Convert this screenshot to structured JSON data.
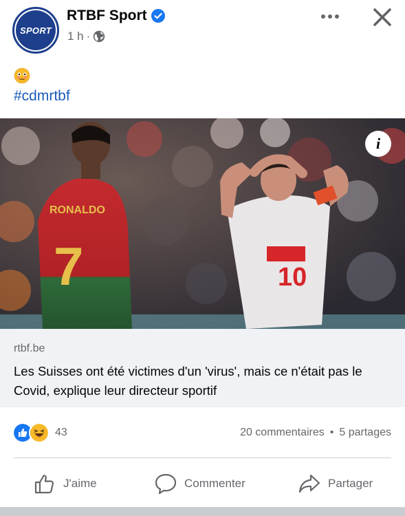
{
  "post": {
    "page_name": "RTBF Sport",
    "avatar_text": "SPORT",
    "time": "1 h",
    "meta_separator": "·",
    "hashtag": "#cdmrtbf",
    "emoji_icon": "flushed-face-emoji"
  },
  "link": {
    "domain": "rtbf.be",
    "title": "Les Suisses ont été victimes d'un 'virus', mais ce n'était pas le Covid, explique leur directeur sportif"
  },
  "photo": {
    "info_label": "i",
    "jersey_left": {
      "name": "RONALDO",
      "number": "7"
    },
    "jersey_right": {
      "number": "10"
    }
  },
  "stats": {
    "reaction_count": "43",
    "comments": "20 commentaires",
    "separator": "•",
    "shares": "5 partages"
  },
  "actions": {
    "like": "J'aime",
    "comment": "Commenter",
    "share": "Partager"
  },
  "colors": {
    "accent": "#1877f2",
    "hashtag": "#1b5bb8",
    "muted": "#65676b",
    "brand": "#1d3f8c"
  }
}
